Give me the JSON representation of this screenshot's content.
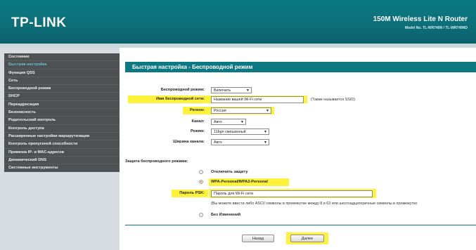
{
  "header": {
    "logo": "TP-LINK",
    "model_title": "150M Wireless Lite N Router",
    "model_sub": "Model No. TL-WR740N / TL-WR749ND"
  },
  "sidebar": {
    "items": [
      {
        "label": "Состояние",
        "active": false
      },
      {
        "label": "Быстрая настройка",
        "active": true
      },
      {
        "label": "Функция QSS",
        "active": false
      },
      {
        "label": "Сеть",
        "active": false
      },
      {
        "label": "Беспроводной режим",
        "active": false
      },
      {
        "label": "DHCP",
        "active": false
      },
      {
        "label": "Переадресация",
        "active": false
      },
      {
        "label": "Безопасность",
        "active": false
      },
      {
        "label": "Родительский контроль",
        "active": false
      },
      {
        "label": "Контроль доступа",
        "active": false
      },
      {
        "label": "Расширенные настройки маршрутизации",
        "active": false
      },
      {
        "label": "Контроль пропускной способности",
        "active": false
      },
      {
        "label": "Привязка IP- и MAC-адресов",
        "active": false
      },
      {
        "label": "Динамический DNS",
        "active": false
      },
      {
        "label": "Системные инструменты",
        "active": false
      }
    ]
  },
  "page_title": "Быстрая настройка - Беспроводной режим",
  "form": {
    "wireless_mode_label": "Беспроводной режим:",
    "wireless_mode_value": "Включить",
    "ssid_label": "Имя беспроводной сети:",
    "ssid_value": "Название вашей Wi-Fi сети",
    "ssid_note": "(Также называется SSID)",
    "region_label": "Регион:",
    "region_value": "Россия",
    "channel_label": "Канал:",
    "channel_value": "Авто",
    "mode_label": "Режим:",
    "mode_value": "11bgn смешанный",
    "width_label": "Ширина канала:",
    "width_value": "Авто",
    "security_heading": "Защита беспроводного режима:",
    "opt_disable": "Отключить защиту",
    "opt_wpa": "WPA-Personal/WPA2-Personal",
    "psk_label": "Пароль PSK:",
    "psk_value": "Пароль для Wi-Fi сети",
    "psk_note": "(Вы можете ввести либо ASCII символы в промежутке между 8 и 63 или шестнадцатеричные символы в промежутке",
    "opt_nochange": "Без Изменений"
  },
  "buttons": {
    "back": "Назад",
    "next": "Далее"
  },
  "colors": {
    "header": "#0d6e78",
    "highlight": "#fff23a",
    "sidebar": "#4e5153"
  }
}
